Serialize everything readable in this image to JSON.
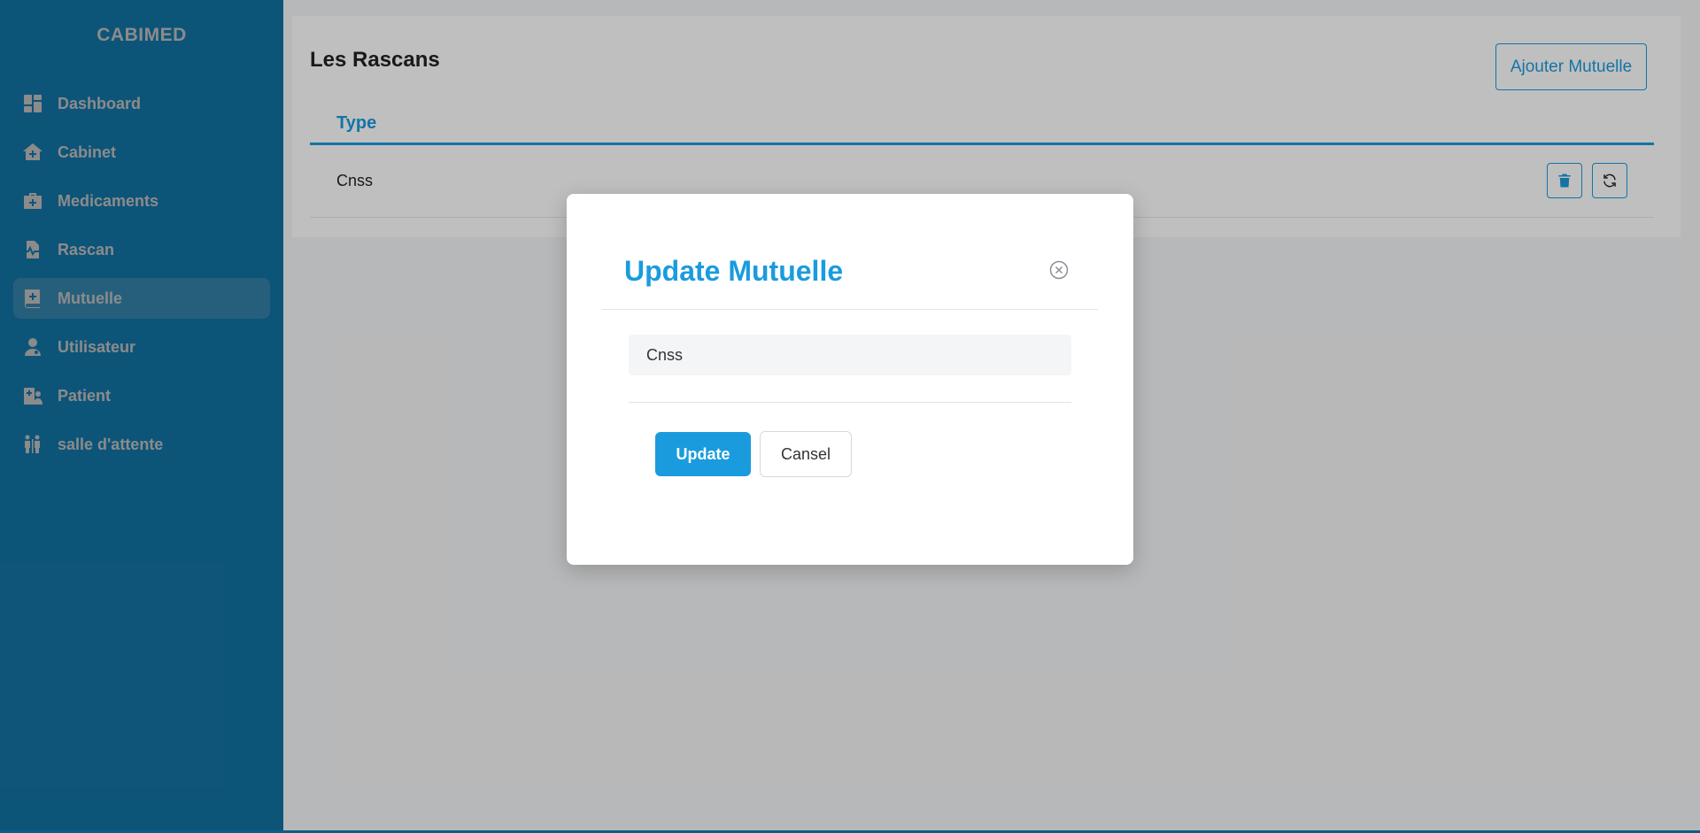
{
  "app": {
    "brand": "CABIMED"
  },
  "sidebar": {
    "items": [
      {
        "label": "Dashboard",
        "icon": "dashboard-icon"
      },
      {
        "label": "Cabinet",
        "icon": "house-medical-icon"
      },
      {
        "label": "Medicaments",
        "icon": "medkit-icon"
      },
      {
        "label": "Rascan",
        "icon": "file-waveform-icon"
      },
      {
        "label": "Mutuelle",
        "icon": "book-medical-icon",
        "active": true
      },
      {
        "label": "Utilisateur",
        "icon": "user-doctor-icon"
      },
      {
        "label": "Patient",
        "icon": "hospital-user-icon"
      },
      {
        "label": "salle d'attente",
        "icon": "people-waiting-icon"
      }
    ]
  },
  "main": {
    "title": "Les Rascans",
    "add_button": "Ajouter Mutuelle",
    "table": {
      "columns": [
        "Type"
      ],
      "rows": [
        {
          "type": "Cnss"
        }
      ]
    }
  },
  "modal": {
    "title": "Update Mutuelle",
    "input_value": "Cnss",
    "update_label": "Update",
    "cancel_label": "Cansel"
  },
  "colors": {
    "accent": "#1a9bde",
    "sidebar_bg": "#1a9bde"
  }
}
